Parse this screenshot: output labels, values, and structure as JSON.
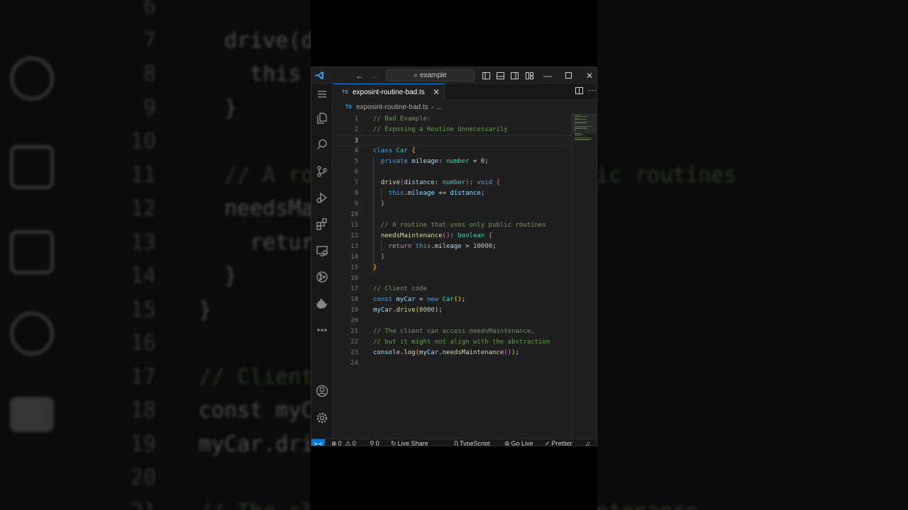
{
  "titlebar": {
    "search_placeholder": "example"
  },
  "tab": {
    "badge": "TS",
    "filename": "exposint-routine-bad.ts"
  },
  "breadcrumb": {
    "badge": "TS",
    "file": "exposint-routine-bad.ts",
    "more": "..."
  },
  "editor": {
    "active_line": 3,
    "lines": [
      {
        "n": "1",
        "tokens": [
          [
            "// Bad Example:",
            "comment"
          ]
        ]
      },
      {
        "n": "2",
        "tokens": [
          [
            "// Exposing a Routine Unnecessarily",
            "comment"
          ]
        ]
      },
      {
        "n": "3",
        "tokens": []
      },
      {
        "n": "4",
        "tokens": [
          [
            "class ",
            "kw"
          ],
          [
            "Car",
            "class"
          ],
          [
            " ",
            ""
          ],
          [
            "{",
            "b1"
          ]
        ]
      },
      {
        "n": "5",
        "tokens": [
          [
            "  ",
            ""
          ],
          [
            "private ",
            "kw"
          ],
          [
            "mileage",
            "var"
          ],
          [
            ": ",
            ""
          ],
          [
            "number",
            "class"
          ],
          [
            " = ",
            ""
          ],
          [
            "0",
            "num"
          ],
          [
            ";",
            ""
          ]
        ]
      },
      {
        "n": "6",
        "tokens": []
      },
      {
        "n": "7",
        "tokens": [
          [
            "  ",
            ""
          ],
          [
            "drive",
            "fn"
          ],
          [
            "(",
            "b2"
          ],
          [
            "distance",
            "var"
          ],
          [
            ": ",
            ""
          ],
          [
            "number",
            "class"
          ],
          [
            ")",
            "b2"
          ],
          [
            ": ",
            ""
          ],
          [
            "void",
            "kw"
          ],
          [
            " ",
            ""
          ],
          [
            "{",
            "b2"
          ]
        ]
      },
      {
        "n": "8",
        "tokens": [
          [
            "    ",
            ""
          ],
          [
            "this",
            "kw"
          ],
          [
            ".",
            ""
          ],
          [
            "mileage",
            "var"
          ],
          [
            " += ",
            ""
          ],
          [
            "distance",
            "var"
          ],
          [
            ";",
            ""
          ]
        ]
      },
      {
        "n": "9",
        "tokens": [
          [
            "  ",
            ""
          ],
          [
            "}",
            "b2"
          ]
        ]
      },
      {
        "n": "10",
        "tokens": []
      },
      {
        "n": "11",
        "tokens": [
          [
            "  ",
            ""
          ],
          [
            "// A routine that uses only public routines",
            "comment"
          ]
        ]
      },
      {
        "n": "12",
        "tokens": [
          [
            "  ",
            ""
          ],
          [
            "needsMaintenance",
            "fn"
          ],
          [
            "()",
            "b2"
          ],
          [
            ": ",
            ""
          ],
          [
            "boolean",
            "class"
          ],
          [
            " ",
            ""
          ],
          [
            "{",
            "b2"
          ]
        ]
      },
      {
        "n": "13",
        "tokens": [
          [
            "    ",
            ""
          ],
          [
            "return ",
            "ctrl"
          ],
          [
            "this",
            "kw"
          ],
          [
            ".",
            ""
          ],
          [
            "mileage",
            "var"
          ],
          [
            " > ",
            ""
          ],
          [
            "10000",
            "num"
          ],
          [
            ";",
            ""
          ]
        ]
      },
      {
        "n": "14",
        "tokens": [
          [
            "  ",
            ""
          ],
          [
            "}",
            "b2"
          ]
        ]
      },
      {
        "n": "15",
        "tokens": [
          [
            "}",
            "b1"
          ]
        ]
      },
      {
        "n": "16",
        "tokens": []
      },
      {
        "n": "17",
        "tokens": [
          [
            "// Client code",
            "comment"
          ]
        ]
      },
      {
        "n": "18",
        "tokens": [
          [
            "const ",
            "kw"
          ],
          [
            "myCar",
            "var"
          ],
          [
            " = ",
            ""
          ],
          [
            "new ",
            "kw"
          ],
          [
            "Car",
            "class"
          ],
          [
            "()",
            "b1"
          ],
          [
            ";",
            ""
          ]
        ]
      },
      {
        "n": "19",
        "tokens": [
          [
            "myCar",
            "var"
          ],
          [
            ".",
            ""
          ],
          [
            "drive",
            "fn"
          ],
          [
            "(",
            "b1"
          ],
          [
            "8000",
            "num"
          ],
          [
            ")",
            "b1"
          ],
          [
            ";",
            ""
          ]
        ]
      },
      {
        "n": "20",
        "tokens": []
      },
      {
        "n": "21",
        "tokens": [
          [
            "// The client can access needsMaintenance,",
            "comment"
          ]
        ]
      },
      {
        "n": "22",
        "tokens": [
          [
            "// but it might not align with the abstraction",
            "comment"
          ]
        ]
      },
      {
        "n": "23",
        "tokens": [
          [
            "console",
            "var"
          ],
          [
            ".",
            ""
          ],
          [
            "log",
            "fn"
          ],
          [
            "(",
            "b1"
          ],
          [
            "myCar",
            "var"
          ],
          [
            ".",
            ""
          ],
          [
            "needsMaintenance",
            "fn"
          ],
          [
            "()",
            "b2"
          ],
          [
            ")",
            "b1"
          ],
          [
            ";",
            ""
          ]
        ]
      },
      {
        "n": "24",
        "tokens": []
      }
    ]
  },
  "statusbar": {
    "errors": "0",
    "warnings": "0",
    "ports": "0",
    "live_share": "Live Share",
    "language": "TypeScript",
    "go_live": "Go Live",
    "prettier": "Prettier"
  },
  "background": {
    "lines": [
      {
        "n": "6",
        "text": ""
      },
      {
        "n": "7",
        "text": "  drive(d                  id {"
      },
      {
        "n": "8",
        "text": "    this"
      },
      {
        "n": "9",
        "text": "  }"
      },
      {
        "n": "10",
        "text": ""
      },
      {
        "n": "11",
        "text": "  // A ro                  public routines"
      },
      {
        "n": "12",
        "text": "  needsMa                   {"
      },
      {
        "n": "13",
        "text": "    retur                  00;"
      },
      {
        "n": "14",
        "text": "  }"
      },
      {
        "n": "15",
        "text": "}"
      },
      {
        "n": "16",
        "text": ""
      },
      {
        "n": "17",
        "text": "// Client"
      },
      {
        "n": "18",
        "text": "const myC"
      },
      {
        "n": "19",
        "text": "myCar.dri"
      },
      {
        "n": "20",
        "text": ""
      },
      {
        "n": "21",
        "text": "// The cl                  sMaintenance"
      }
    ]
  },
  "colors": {
    "accent": "#0078d4",
    "editor_bg": "#1f1f1f",
    "comment": "#6a9955"
  }
}
